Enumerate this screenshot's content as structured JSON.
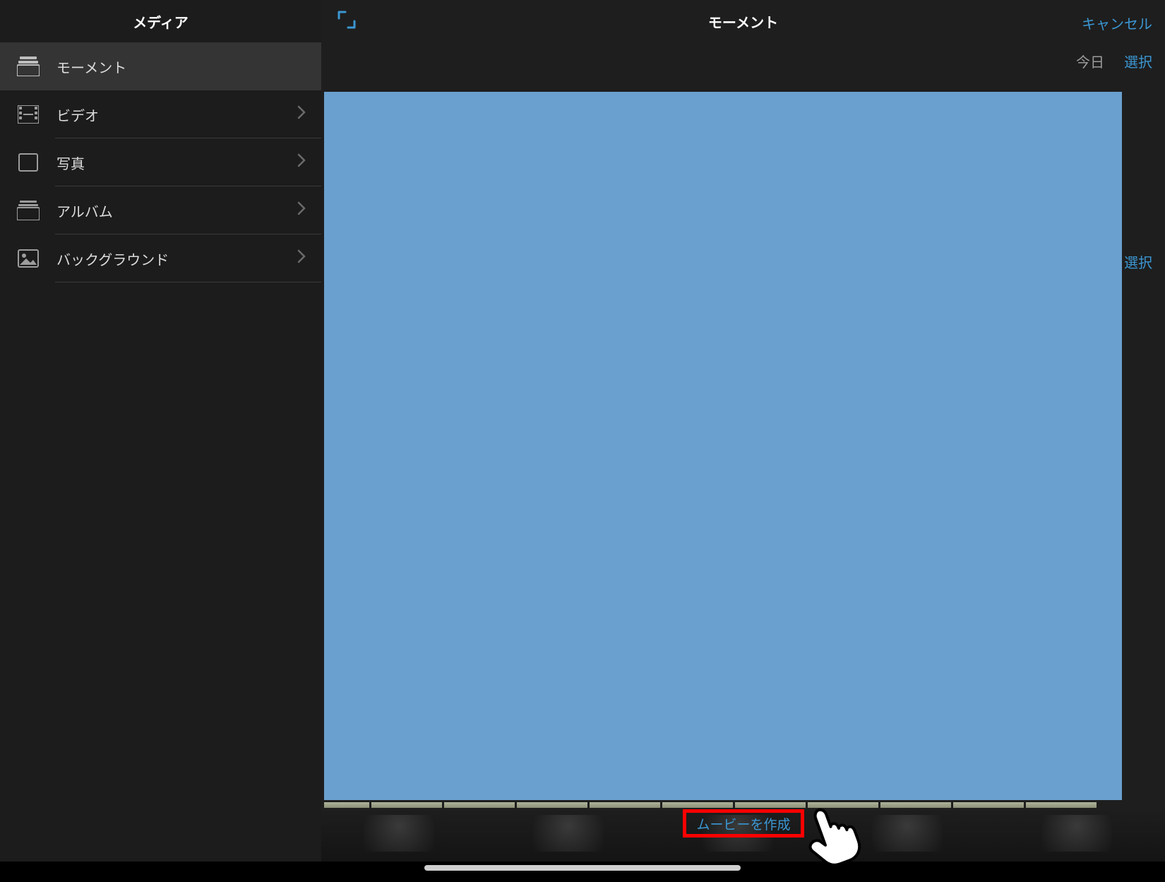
{
  "sidebar": {
    "title": "メディア",
    "items": [
      {
        "label": "モーメント",
        "icon": "stack-icon",
        "active": true,
        "chevron": false
      },
      {
        "label": "ビデオ",
        "icon": "film-icon",
        "active": false,
        "chevron": true
      },
      {
        "label": "写真",
        "icon": "square-icon",
        "active": false,
        "chevron": true
      },
      {
        "label": "アルバム",
        "icon": "stack-icon",
        "active": false,
        "chevron": true
      },
      {
        "label": "バックグラウンド",
        "icon": "image-icon",
        "active": false,
        "chevron": true
      }
    ]
  },
  "main": {
    "title": "モーメント",
    "cancel": "キャンセル",
    "today": "今日",
    "select": "選択",
    "side_select": "選択",
    "create_movie": "ムービーを作成"
  },
  "colors": {
    "accent": "#3b97d3",
    "preview": "#6aa0cf",
    "highlight_border": "#ff0000"
  }
}
